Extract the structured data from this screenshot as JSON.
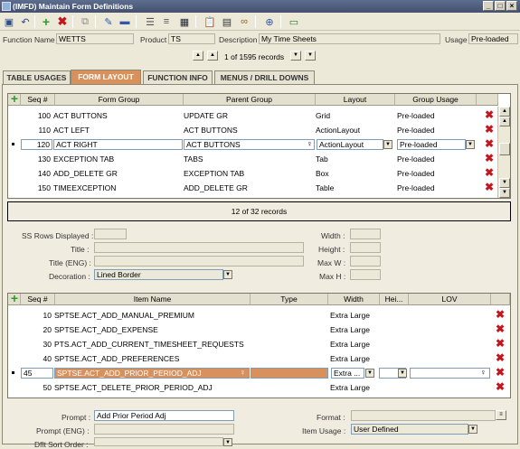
{
  "window": {
    "title": "(IMFD) Maintain Form Definitions"
  },
  "header": {
    "function_name_label": "Function Name",
    "function_name_value": "WETTS",
    "product_label": "Product",
    "product_value": "TS",
    "description_label": "Description",
    "description_value": "My Time Sheets",
    "usage_label": "Usage",
    "usage_value": "Pre-loaded",
    "record_count": "1 of 1595 records"
  },
  "tabs": [
    {
      "label": "TABLE USAGES"
    },
    {
      "label": "FORM LAYOUT"
    },
    {
      "label": "FUNCTION INFO"
    },
    {
      "label": "MENUS / DRILL DOWNS"
    }
  ],
  "grid1": {
    "columns": [
      "Seq #",
      "Form Group",
      "Parent Group",
      "Layout",
      "Group Usage"
    ],
    "rows": [
      {
        "seq": "100",
        "form_group": "ACT BUTTONS",
        "parent_group": "UPDATE GR",
        "layout": "Grid",
        "usage": "Pre-loaded"
      },
      {
        "seq": "110",
        "form_group": "ACT LEFT",
        "parent_group": "ACT BUTTONS",
        "layout": "ActionLayout",
        "usage": "Pre-loaded"
      },
      {
        "seq": "120",
        "form_group": "ACT RIGHT",
        "parent_group": "ACT BUTTONS",
        "layout": "ActionLayout",
        "usage": "Pre-loaded"
      },
      {
        "seq": "130",
        "form_group": "EXCEPTION TAB",
        "parent_group": "TABS",
        "layout": "Tab",
        "usage": "Pre-loaded"
      },
      {
        "seq": "140",
        "form_group": "ADD_DELETE GR",
        "parent_group": "EXCEPTION TAB",
        "layout": "Box",
        "usage": "Pre-loaded"
      },
      {
        "seq": "150",
        "form_group": "TIMEEXCEPTION",
        "parent_group": "ADD_DELETE GR",
        "layout": "Table",
        "usage": "Pre-loaded"
      }
    ],
    "status": "12 of 32 records"
  },
  "props1": {
    "ss_rows_label": "SS Rows Displayed :",
    "title_label": "Title :",
    "title_eng_label": "Title  (ENG) :",
    "decoration_label": "Decoration :",
    "decoration_value": "Lined Border",
    "width_label": "Width :",
    "height_label": "Height :",
    "maxw_label": "Max W :",
    "maxh_label": "Max H :"
  },
  "grid2": {
    "columns": [
      "Seq #",
      "Item Name",
      "Type",
      "Width",
      "Hei...",
      "LOV"
    ],
    "rows": [
      {
        "seq": "10",
        "item": "SPTSE.ACT_ADD_MANUAL_PREMIUM",
        "width": "Extra Large"
      },
      {
        "seq": "20",
        "item": "SPTSE.ACT_ADD_EXPENSE",
        "width": "Extra Large"
      },
      {
        "seq": "30",
        "item": "PTS.ACT_ADD_CURRENT_TIMESHEET_REQUESTS",
        "width": "Extra Large"
      },
      {
        "seq": "40",
        "item": "SPTSE.ACT_ADD_PREFERENCES",
        "width": "Extra Large"
      },
      {
        "seq": "45",
        "item": "SPTSE.ACT_ADD_PRIOR_PERIOD_ADJ",
        "width": "Extra ..."
      },
      {
        "seq": "50",
        "item": "SPTSE.ACT_DELETE_PRIOR_PERIOD_ADJ",
        "width": "Extra Large"
      }
    ]
  },
  "props2": {
    "prompt_label": "Prompt :",
    "prompt_value": "Add Prior Period Adj",
    "prompt_eng_label": "Prompt  (ENG) :",
    "dflt_sort_label": "Dflt Sort Order :",
    "format_label": "Format :",
    "item_usage_label": "Item Usage :",
    "item_usage_value": "User Defined"
  },
  "colors": {
    "accent": "#d8915c",
    "delete": "#c0181e",
    "add": "#2c9b2c"
  }
}
